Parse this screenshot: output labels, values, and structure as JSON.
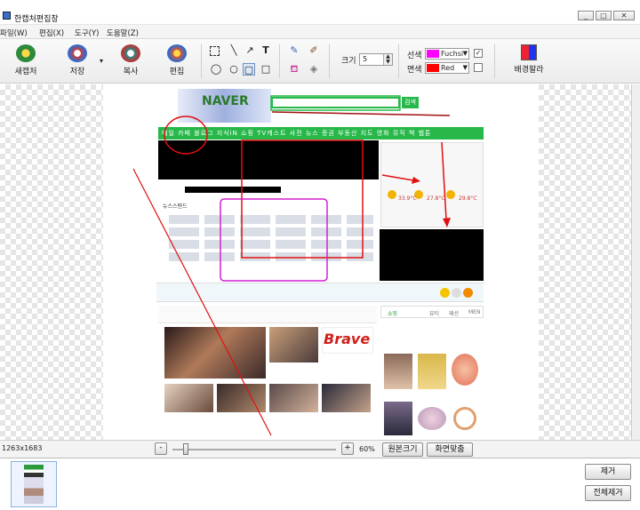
{
  "window": {
    "title": "한캡처편집창",
    "minimize": "_",
    "maximize": "□",
    "close": "✕"
  },
  "menu": [
    "파일(W)",
    "편집(X)",
    "도구(Y)",
    "도움말(Z)"
  ],
  "toolbar": {
    "new_label": "새캡처",
    "save_label": "저장",
    "copy_label": "복사",
    "edit_label": "편집",
    "size_label": "크기",
    "size_value": "5",
    "line_color_label": "선색",
    "line_color_value": "Fuchsi",
    "fill_color_label": "면색",
    "fill_color_value": "Red",
    "palette_label": "배경팔라",
    "line_color_hex": "#ff00ff",
    "fill_color_hex": "#ff0000"
  },
  "status": {
    "dimensions": "1263x1683",
    "zoom": "60%",
    "original_size_label": "원본크기",
    "fit_screen_label": "화면맞춤"
  },
  "side": {
    "delete_label": "제거",
    "delete_all_label": "전체제거"
  },
  "page": {
    "logo_text": "NAVER",
    "search_button": "검색",
    "weather_temps": [
      "33.9°C",
      "27.8°C",
      "29.8°C"
    ],
    "news_label": "뉴스스탠드",
    "brand_text": "Brave",
    "tab_labels": [
      "쇼핑",
      "뷰티",
      "패션",
      "MEN"
    ]
  }
}
